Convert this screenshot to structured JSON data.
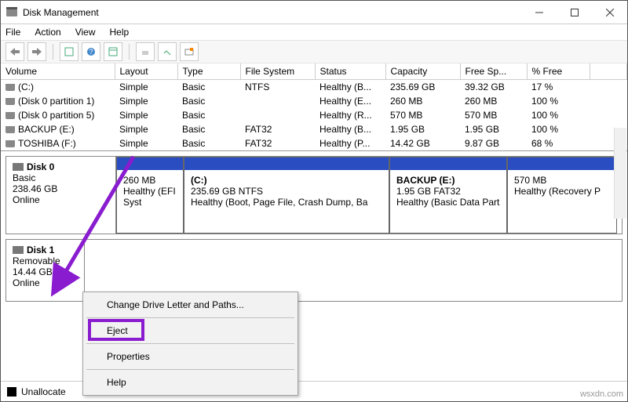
{
  "window": {
    "title": "Disk Management"
  },
  "menubar": [
    "File",
    "Action",
    "View",
    "Help"
  ],
  "columns": [
    "Volume",
    "Layout",
    "Type",
    "File System",
    "Status",
    "Capacity",
    "Free Sp...",
    "% Free"
  ],
  "volumes": [
    {
      "name": "(C:)",
      "layout": "Simple",
      "type": "Basic",
      "fs": "NTFS",
      "status": "Healthy (B...",
      "capacity": "235.69 GB",
      "free": "39.32 GB",
      "pct": "17 %"
    },
    {
      "name": "(Disk 0 partition 1)",
      "layout": "Simple",
      "type": "Basic",
      "fs": "",
      "status": "Healthy (E...",
      "capacity": "260 MB",
      "free": "260 MB",
      "pct": "100 %"
    },
    {
      "name": "(Disk 0 partition 5)",
      "layout": "Simple",
      "type": "Basic",
      "fs": "",
      "status": "Healthy (R...",
      "capacity": "570 MB",
      "free": "570 MB",
      "pct": "100 %"
    },
    {
      "name": "BACKUP (E:)",
      "layout": "Simple",
      "type": "Basic",
      "fs": "FAT32",
      "status": "Healthy (B...",
      "capacity": "1.95 GB",
      "free": "1.95 GB",
      "pct": "100 %"
    },
    {
      "name": "TOSHIBA (F:)",
      "layout": "Simple",
      "type": "Basic",
      "fs": "FAT32",
      "status": "Healthy (P...",
      "capacity": "14.42 GB",
      "free": "9.87 GB",
      "pct": "68 %"
    }
  ],
  "disk0": {
    "label": "Disk 0",
    "type": "Basic",
    "size": "238.46 GB",
    "status": "Online",
    "partitions": [
      {
        "title": "",
        "line1": "260 MB",
        "line2": "Healthy (EFI Syst"
      },
      {
        "title": "(C:)",
        "line1": "235.69 GB NTFS",
        "line2": "Healthy (Boot, Page File, Crash Dump, Ba"
      },
      {
        "title": "BACKUP  (E:)",
        "line1": "1.95 GB FAT32",
        "line2": "Healthy (Basic Data Part"
      },
      {
        "title": "",
        "line1": "570 MB",
        "line2": "Healthy (Recovery P"
      }
    ]
  },
  "disk1": {
    "label": "Disk 1",
    "type": "Removable",
    "size": "14.44 GB",
    "status": "Online"
  },
  "legend": {
    "unallocated": "Unallocate"
  },
  "context_menu": {
    "change": "Change Drive Letter and Paths...",
    "eject": "Eject",
    "properties": "Properties",
    "help": "Help"
  },
  "watermark": "wsxdn.com"
}
